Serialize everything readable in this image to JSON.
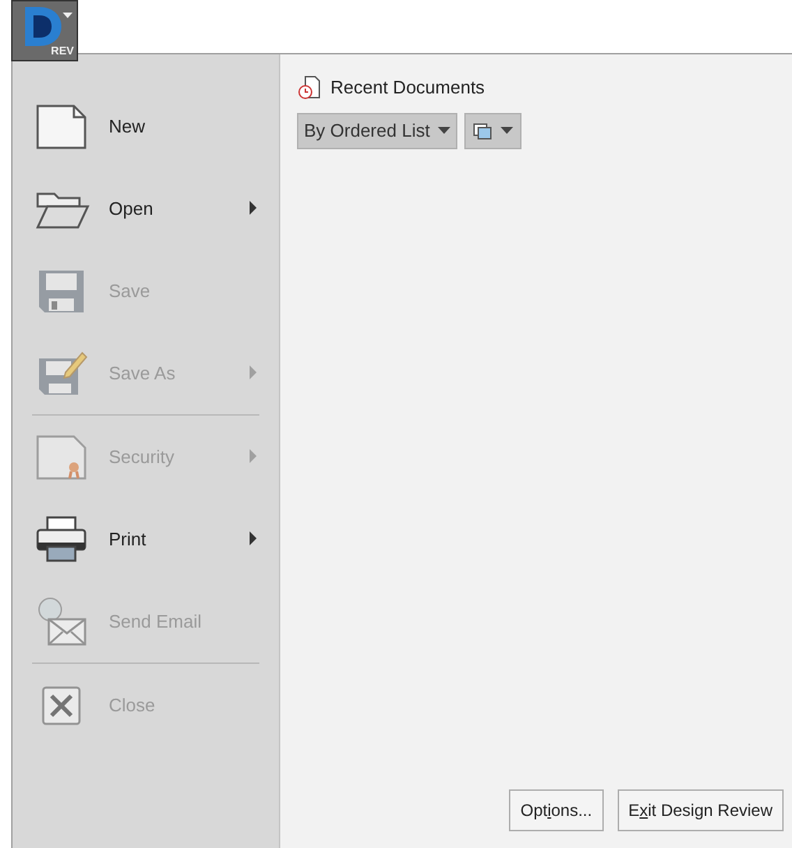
{
  "app_button": {
    "label": "REV"
  },
  "menu": [
    {
      "kind": "item",
      "label": "New",
      "disabled": false,
      "submenu": false
    },
    {
      "kind": "item",
      "label": "Open",
      "disabled": false,
      "submenu": true
    },
    {
      "kind": "item",
      "label": "Save",
      "disabled": true,
      "submenu": false
    },
    {
      "kind": "item",
      "label": "Save As",
      "disabled": true,
      "submenu": true
    },
    {
      "kind": "separator"
    },
    {
      "kind": "item",
      "label": "Security",
      "disabled": true,
      "submenu": true
    },
    {
      "kind": "item",
      "label": "Print",
      "disabled": false,
      "submenu": true
    },
    {
      "kind": "item",
      "label": "Send Email",
      "disabled": true,
      "submenu": false
    },
    {
      "kind": "separator"
    },
    {
      "kind": "item",
      "label": "Close",
      "disabled": true,
      "submenu": false
    }
  ],
  "recent": {
    "title": "Recent Documents",
    "sort_dropdown": "By Ordered List"
  },
  "buttons": [
    {
      "label": "Options..."
    },
    {
      "label": "Exit Design Review"
    }
  ]
}
